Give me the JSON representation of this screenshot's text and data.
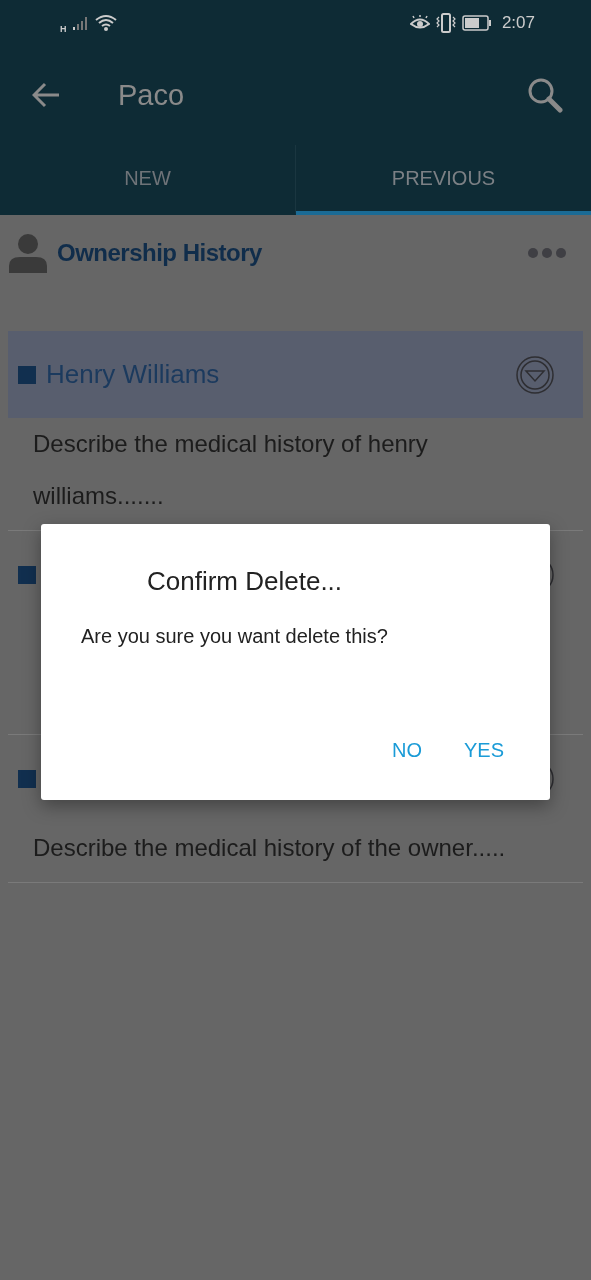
{
  "status_bar": {
    "network": "H",
    "time": "2:07"
  },
  "toolbar": {
    "title": "Paco"
  },
  "tabs": [
    {
      "label": "NEW",
      "selected": false
    },
    {
      "label": "PREVIOUS",
      "selected": true
    }
  ],
  "section": {
    "title": "Ownership History"
  },
  "entries": [
    {
      "title": "Henry Williams",
      "description": "Describe the medical history of henry williams.......",
      "selected": true
    },
    {
      "selected": false
    },
    {
      "description": "Describe the medical history of the owner.....",
      "selected": false
    }
  ],
  "dialog": {
    "title": "Confirm Delete...",
    "message": "Are you sure you want delete this?",
    "buttons": [
      "NO",
      "YES"
    ]
  }
}
